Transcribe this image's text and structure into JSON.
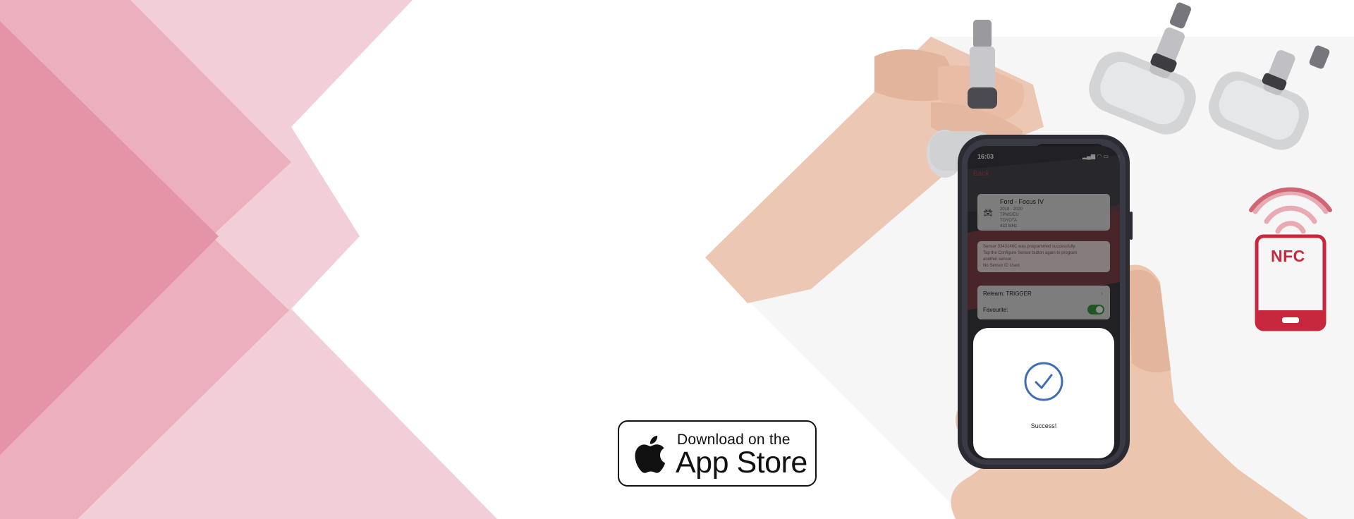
{
  "colors": {
    "pink_light": "#f2cfd8",
    "pink_mid": "#ebafbd",
    "pink_dark": "#e594a7",
    "nfc_red": "#c8283e",
    "success_blue": "#3f6db3",
    "toggle_green": "#3f9b46"
  },
  "app_store_badge": {
    "icon": "apple-logo-icon",
    "line1": "Download on the",
    "line2": "App Store"
  },
  "phone_screen": {
    "time": "16:03",
    "status_icons": "signal-wifi-battery-icon",
    "back_label": "Back",
    "vehicle": {
      "icon": "car-icon",
      "title": "Ford - Focus IV",
      "details": [
        "2018 - 2020",
        "TPMS/EU",
        "TOYOTA",
        "433 MHz"
      ]
    },
    "message_lines": [
      "Sensor 3343146C was programmed successfully.",
      "Tap the Configure Sensor button again to program",
      "another sensor.",
      "No Sensor ID Used"
    ],
    "settings": {
      "relearn_label": "Relearn: TRIGGER",
      "favourite_label": "Favourite:",
      "favourite_on": true
    },
    "sheet": {
      "icon": "check-circle-icon",
      "status_text": "Success!"
    }
  },
  "nfc_icon": {
    "label": "NFC",
    "icon": "nfc-phone-icon"
  }
}
